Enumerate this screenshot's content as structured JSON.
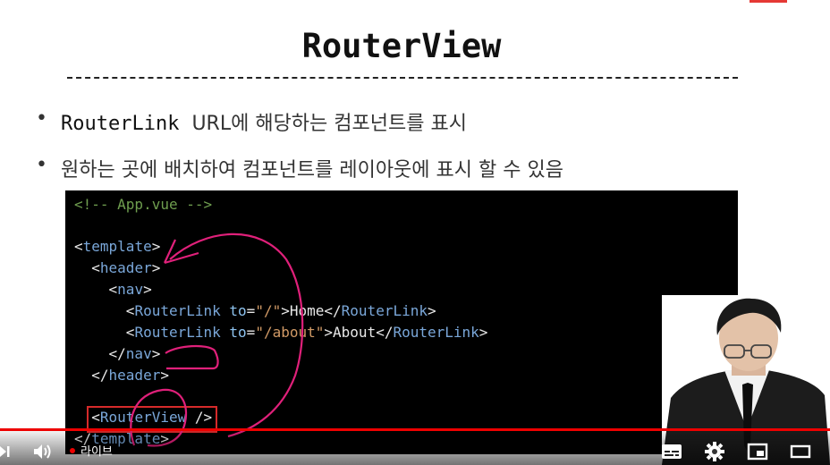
{
  "slide": {
    "title": "RouterView",
    "bullets": [
      {
        "code": "RouterLink",
        "text": "URL에 해당하는 컴포넌트를 표시"
      },
      {
        "code": "",
        "text": "원하는 곳에 배치하여 컴포넌트를 레이아웃에 표시 할 수 있음"
      }
    ],
    "code_lines": [
      {
        "indent": "",
        "comment": "<!-- App.vue -->"
      },
      {
        "indent": "",
        "open": "<",
        "tag": "template",
        "close": ">"
      },
      {
        "indent": "  ",
        "open": "<",
        "tag": "header",
        "close": ">"
      },
      {
        "indent": "    ",
        "open": "<",
        "tag": "nav",
        "close": ">"
      },
      {
        "indent": "      ",
        "open": "<",
        "tag": "RouterLink",
        "attr": " to",
        "eq": "=",
        "val": "\"/\"",
        "close": ">",
        "text": "Home",
        "end_open": "</",
        "end_tag": "RouterLink",
        "end_close": ">"
      },
      {
        "indent": "      ",
        "open": "<",
        "tag": "RouterLink",
        "attr": " to",
        "eq": "=",
        "val": "\"/about\"",
        "close": ">",
        "text": "About",
        "end_open": "</",
        "end_tag": "RouterLink",
        "end_close": ">"
      },
      {
        "indent": "    ",
        "open": "</",
        "tag": "nav",
        "close": ">"
      },
      {
        "indent": "  ",
        "open": "</",
        "tag": "header",
        "close": ">"
      },
      {
        "indent": "  ",
        "open": "<",
        "tag": "RouterView",
        "close": " />"
      },
      {
        "indent": "",
        "open": "</",
        "tag": "template",
        "close": ">"
      }
    ]
  },
  "player": {
    "live_label": "라이브",
    "icons": {
      "next": "next-icon",
      "volume": "volume-icon",
      "subtitles": "subtitles-icon",
      "settings": "settings-icon",
      "miniplayer": "miniplayer-icon",
      "theater": "theater-icon"
    },
    "progress": 1.0,
    "accent": "#ee0000"
  }
}
